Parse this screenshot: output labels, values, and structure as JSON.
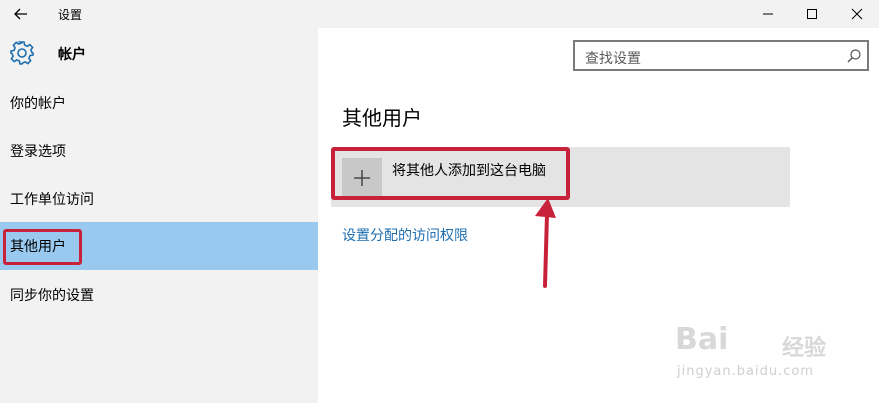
{
  "window": {
    "title": "设置",
    "minimize_icon": "minimize-icon",
    "maximize_icon": "maximize-icon",
    "close_icon": "close-icon",
    "back_icon": "back-arrow-icon"
  },
  "header": {
    "icon": "gear-icon",
    "title": "帐户"
  },
  "search": {
    "placeholder": "查找设置",
    "icon": "search-icon"
  },
  "sidebar": {
    "items": [
      {
        "label": "你的帐户",
        "active": false
      },
      {
        "label": "登录选项",
        "active": false
      },
      {
        "label": "工作单位访问",
        "active": false
      },
      {
        "label": "其他用户",
        "active": true
      },
      {
        "label": "同步你的设置",
        "active": false
      }
    ]
  },
  "main": {
    "title": "其他用户",
    "add_tile": {
      "icon": "plus-icon",
      "label": "将其他人添加到这台电脑"
    },
    "access_link": "设置分配的访问权限"
  },
  "watermark": {
    "brand": "Bai",
    "cn": "经验",
    "url": "jingyan.baidu.com"
  },
  "colors": {
    "titlebar_bg": "#f2f2f2",
    "active_item_bg": "#99c9ef",
    "highlight_red": "#c8223b",
    "link": "#1e6eb0",
    "tile_bg": "#e4e4e4"
  }
}
